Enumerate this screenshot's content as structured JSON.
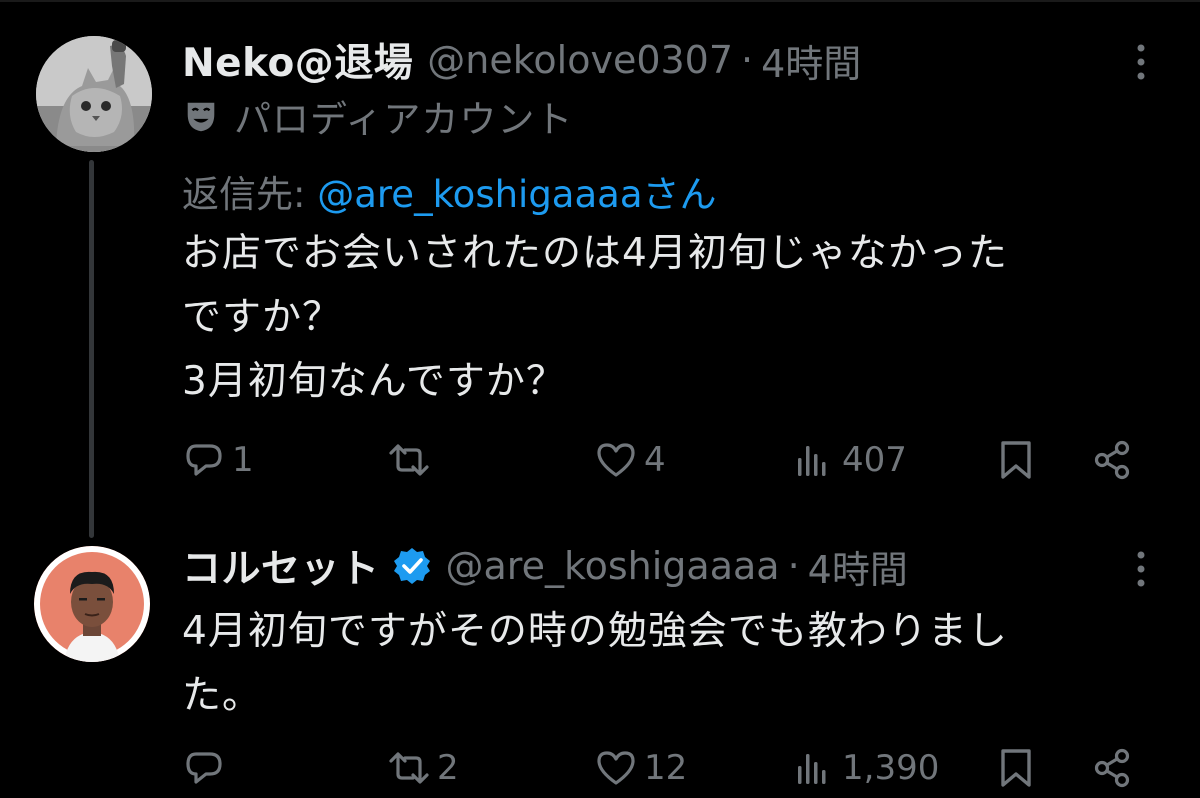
{
  "tweets": [
    {
      "display_name": "Neko@退場",
      "handle": "@nekolove0307",
      "separator": "·",
      "time": "4時間",
      "badge_label": "パロディアカウント",
      "reply_prefix": "返信先:",
      "reply_handle": "@are_koshigaaaaさん",
      "text": "お店でお会いされたのは4月初旬じゃなかった\nですか？\n3月初旬なんですか？",
      "replies": "1",
      "retweets": "",
      "likes": "4",
      "views": "407",
      "avatar_icon": "cat-photo-avatar"
    },
    {
      "display_name": "コルセット",
      "handle": "@are_koshigaaaa",
      "separator": "·",
      "time": "4時間",
      "verified": true,
      "text": "4月初旬ですがその時の勉強会でも教わりまし\nた。",
      "replies": "",
      "retweets": "2",
      "likes": "12",
      "views": "1,390",
      "avatar_icon": "illustrated-man-avatar"
    }
  ],
  "colors": {
    "background": "#000000",
    "text_primary": "#e7e9ea",
    "text_secondary": "#71767b",
    "link": "#1d9bf0",
    "thread_line": "#333639",
    "verified_badge": "#1d9bf0"
  }
}
